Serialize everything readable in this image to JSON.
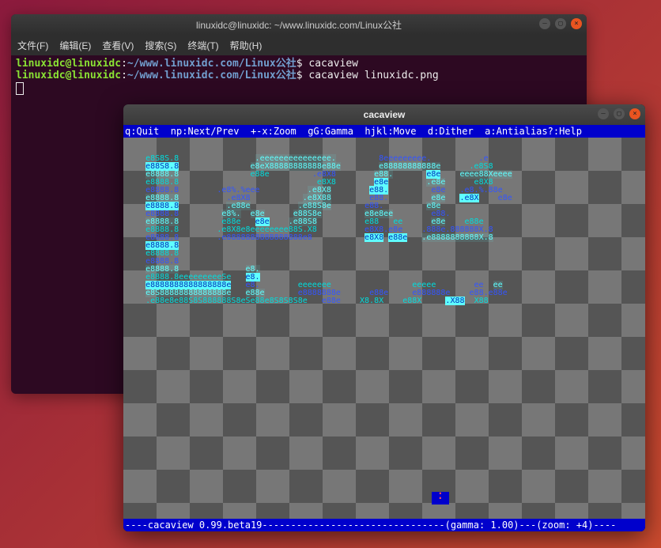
{
  "terminal": {
    "title": "linuxidc@linuxidc: ~/www.linuxidc.com/Linux公社",
    "menu": {
      "file": "文件(F)",
      "edit": "编辑(E)",
      "view": "查看(V)",
      "search": "搜索(S)",
      "terminal": "终端(T)",
      "help": "帮助(H)"
    },
    "prompt_user": "linuxidc@linuxidc",
    "prompt_sep": ":",
    "prompt_path": "~/www.linuxidc.com/Linux公社",
    "prompt_dollar": "$",
    "cmd1": "cacaview",
    "cmd2": "cacaview linuxidc.png"
  },
  "cacaview": {
    "title": "cacaview",
    "help": "q:Quit  np:Next/Prev  +-x:Zoom  gG:Gamma  hjkl:Move  d:Dither  a:Antialias?:Help",
    "status_prefix": "----cacaview ",
    "version": "0.99.beta19",
    "status_mid": "--------------------------------(gamma: ",
    "gamma": "1.00",
    "status_mid2": ")---(zoom: ",
    "zoom": "+4",
    "status_suffix": ")----",
    "art": [
      "                                                                               ",
      "   e8S8S.8                .eeeeeeeeeeeeeee.         8eeeeeeeee.          .e     ",
      "   e88S8.8               e8eX88888888888e88e        e88888888888e      .e8S8    ",
      "   e8888.8               e88e         .e8X8        e88.       e8e    eeee88Xeeee",
      "   e8888.8                             e8X8        e8e        .e8e      e8X8    ",
      "   e8888.8        .e8%.%eee          .e8X8        e88.         e8e   .e8.%.88e  ",
      "   e8888.8          .e8X8           .e8X88        e88.         e8e   .e8X    e8e",
      "   e8888.8          .e88e          .e88S8e       e88.         e8e               ",
      "   e8888.8         e8%.  e8e      e88S8e         e8e8ee        e88.             ",
      "   e8888.8         e88e   e8e    .e88S8          e88   ee      e8e    e88e      ",
      "   e8888.8        .e8X8e8eeeeeeee88S.X8          e8X8.e8e    .888e.888888X.8   ",
      "   e8888.8        .e8888888888888888e8           e8X8 e88e   .e8888888888X.8   ",
      "   e8888.8                                                                      ",
      "   e8888.8                                                                      ",
      "   e8888.8                                                                      ",
      "   e8888.8              e8.                                                    ",
      "   e8888.8eeeeeeeeeSe   e8.                                                    ",
      "   e8888888888888888e   e8.        eeeeeee                 eeeee        ee  ee ",
      "   e8S88888888888888e   e88e       e8888888e      e88e     e888888e    e88.e88e",
      "   .e88e8e88S8S888888S8eSe88e8S8S8S8e   e88e    X8.8X    e88X     .X88  X88",
      "                                                                                "
    ]
  }
}
